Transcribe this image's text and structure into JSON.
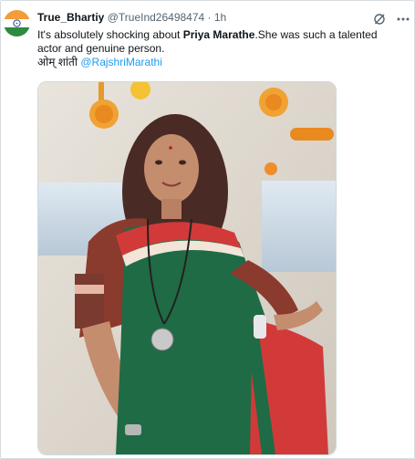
{
  "tweet": {
    "display_name": "True_Bhartiy",
    "handle": "@TrueInd26498474",
    "separator": "·",
    "time": "1h",
    "text_line1_prefix": "It's absolutely shocking about ",
    "text_line1_bold": "Priya Marathe",
    "text_line1_suffix": ".She was such a talented actor and genuine person.",
    "text_line2_prefix": "ओम् शांती ",
    "mention": "@RajshriMarathi"
  },
  "icons": {
    "grok": "grok-icon",
    "more": "more-options-icon",
    "avatar_flag": "indian-flag-avatar"
  },
  "colors": {
    "accent": "#1d9bf0",
    "secondary_text": "#536471",
    "saree_green": "#1f6b45",
    "saree_red": "#d23a3a"
  }
}
